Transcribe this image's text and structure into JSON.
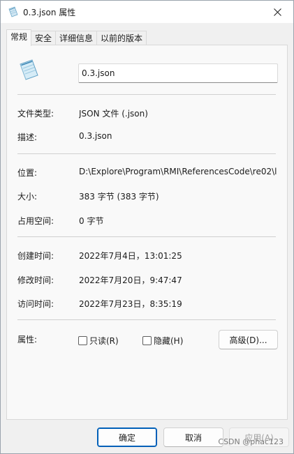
{
  "window": {
    "title": "0.3.json 属性",
    "icon": "notepad-file-icon"
  },
  "tabs": [
    {
      "label": "常规",
      "active": true
    },
    {
      "label": "安全",
      "active": false
    },
    {
      "label": "详细信息",
      "active": false
    },
    {
      "label": "以前的版本",
      "active": false
    }
  ],
  "general": {
    "file_name": "0.3.json",
    "file_type_label": "文件类型:",
    "file_type_value": "JSON 文件 (.json)",
    "description_label": "描述:",
    "description_value": "0.3.json",
    "location_label": "位置:",
    "location_value": "D:\\Explore\\Program\\RMI\\ReferencesCode\\re02\\l",
    "size_label": "大小:",
    "size_value": "383 字节 (383 字节)",
    "size_on_disk_label": "占用空间:",
    "size_on_disk_value": "0 字节",
    "created_label": "创建时间:",
    "created_value": "2022年7月4日，13:01:25",
    "modified_label": "修改时间:",
    "modified_value": "2022年7月20日，9:47:47",
    "accessed_label": "访问时间:",
    "accessed_value": "2022年7月23日，8:35:19",
    "attributes_label": "属性:",
    "readonly_label": "只读(R)",
    "hidden_label": "隐藏(H)",
    "advanced_label": "高级(D)..."
  },
  "footer": {
    "ok_label": "确定",
    "cancel_label": "取消",
    "apply_label": "应用(A)"
  },
  "watermark": "CSDN @phac123",
  "colors": {
    "accent": "#005fb8",
    "panel": "#f9f9f9",
    "window": "#f0f0f0"
  }
}
